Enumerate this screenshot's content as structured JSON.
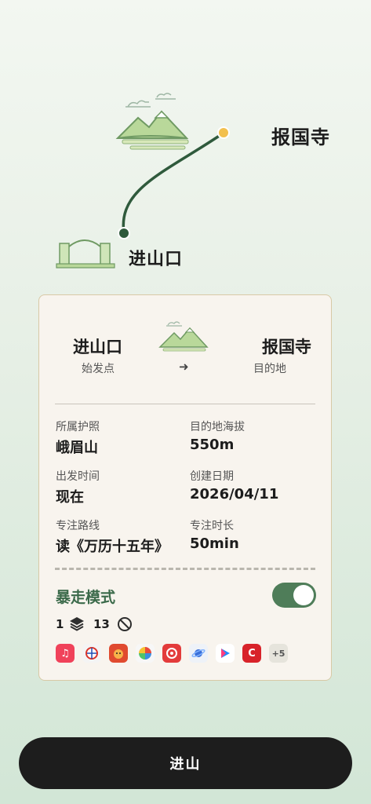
{
  "map": {
    "destination_label": "报国寺",
    "start_label": "进山口"
  },
  "card": {
    "start": {
      "name": "进山口",
      "sub": "始发点"
    },
    "end": {
      "name": "报国寺",
      "sub": "目的地"
    },
    "arrow": "➜",
    "fields": {
      "permit_label": "所属护照",
      "permit_value": "峨眉山",
      "altitude_label": "目的地海拔",
      "altitude_value": "550m",
      "depart_label": "出发时间",
      "depart_value": "现在",
      "created_label": "创建日期",
      "created_value": "2026/04/11",
      "route_label": "专注路线",
      "route_value": "读《万历十五年》",
      "duration_label": "专注时长",
      "duration_value": "50min"
    },
    "mode": {
      "title": "暴走模式",
      "toggle_on": true,
      "count_a": "1",
      "count_b": "13"
    },
    "apps_more": "+5"
  },
  "colors": {
    "accent": "#4f7d59",
    "path": "#2f5a3c",
    "dest_dot": "#f2c04e",
    "cta": "#1d1d1d"
  },
  "cta_label": "进山"
}
